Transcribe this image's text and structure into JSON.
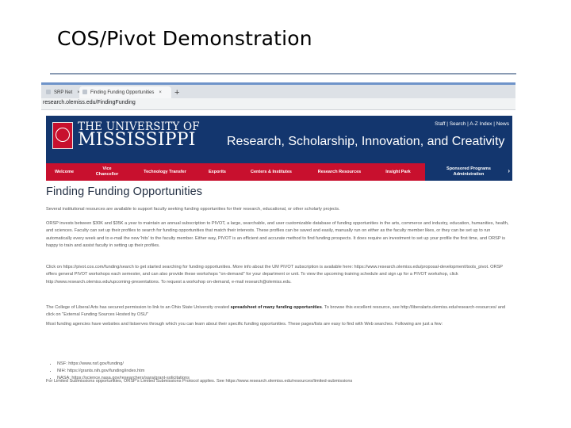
{
  "slide": {
    "title": "COS/Pivot Demonstration"
  },
  "browser": {
    "tabs": [
      {
        "label": "SRP Net",
        "close": "×"
      },
      {
        "label": "Finding Funding Opportunities",
        "close": "×"
      }
    ],
    "new_tab": "+",
    "url": "research.olemiss.edu/FindingFunding"
  },
  "site": {
    "logo_line1": "THE UNIVERSITY OF",
    "logo_line2": "MISSISSIPPI",
    "tagline": "Research, Scholarship, Innovation, and Creativity",
    "utility_links": "Staff | Search | A-Z Index | News",
    "nav": {
      "welcome": "Welcome",
      "vice_chancellor": "Vice Chancellor",
      "technology_transfer": "Technology Transfer",
      "exporits": "Exporits",
      "centers": "Centers & Institutes",
      "research_resources": "Research Resources",
      "insight_park": "Insight Park",
      "sponsored_programs": "Sponsored Programs Administration",
      "chevron": "›"
    },
    "colors": {
      "header_blue": "#13366e",
      "nav_red": "#c8102e"
    }
  },
  "content": {
    "heading": "Finding Funding Opportunities",
    "p1": "Several institutional resources are available to support faculty seeking funding opportunities for their research, educational, or other scholarly projects.",
    "p2": "ORSP invests between $30K and $35K a year to maintain an annual subscription to PIVOT, a large, searchable, and user customizable database of funding opportunities in the arts, commerce and industry, education, humanities, health, and sciences. Faculty can set up their profiles to search for funding opportunities that match their interests. These profiles can be saved and easily, manually run on either as the faculty member likes, or they can be set up to run automatically every week and to e-mail the new 'hits' to the faculty member. Either way, PIVOT is an efficient and accurate method to find funding prospects. It does require an investment to set up your profile the first time, and ORSP is happy to train and assist faculty in setting up their profiles.",
    "p3": "Click on https://pivot.cos.com/funding/search to get started searching for funding opportunities. More info about the UM PIVOT subscription is available here: https://www.research.olemiss.edu/proposal-development/tools_pivot. ORSP offers general PIVOT workshops each semester, and can also provide these workshops \"on-demand\" for your department or unit. To view the upcoming training schedule and sign up for a PIVOT workshop, click http://www.research.olemiss.edu/upcoming-presentations. To request a workshop on-demand, e-mail research@olemiss.edu.",
    "p4_part1": "The College of Liberal Arts has secured permission to link to an Ohio State University created ",
    "p4_bold": "spreadsheet of many funding opportunities",
    "p4_part2": ". To browse this excellent resource, see http://liberalarts.olemiss.edu/research-resources/ and click on \"External Funding Sources Hosted by OSU\"",
    "p5": "Most funding agencies have websites and listserves through which you can learn about their specific funding opportunities. These pages/lists are easy to find with Web searches. Following are just a few:",
    "funders": [
      "NSF: https://www.nsf.gov/funding/",
      "NIH: https://grants.nih.gov/funding/index.htm",
      "NASA: https://science.nasa.gov/researchers/sara/grant-solicitations"
    ],
    "p6": "For Limited Submissions opportunities, ORSP's Limited Submissions Protocol applies. See https://www.research.olemiss.edu/resources/limited-submissions"
  }
}
